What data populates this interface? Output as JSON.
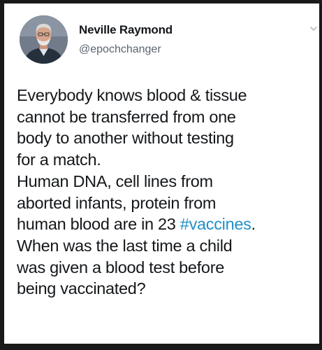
{
  "author": {
    "display_name": "Neville Raymond",
    "handle": "@epochchanger"
  },
  "icons": {
    "menu": "chevron-down-icon",
    "avatar": "profile-photo"
  },
  "colors": {
    "background": "#ffffff",
    "frame": "#1a1a1a",
    "text": "#14171a",
    "muted": "#5b6470",
    "hashtag": "#1f8fc6"
  },
  "tweet": {
    "lines": [
      "Everybody knows blood & tissue",
      "cannot be transferred from one",
      "body to another without testing",
      "for a match.",
      "Human DNA, cell lines from",
      "aborted infants, protein from",
      "human blood are in 23 ",
      "When was the last time a child",
      "was given a blood test before",
      "being vaccinated?"
    ],
    "hashtag": "#vaccines",
    "hashtag_suffix": "."
  }
}
